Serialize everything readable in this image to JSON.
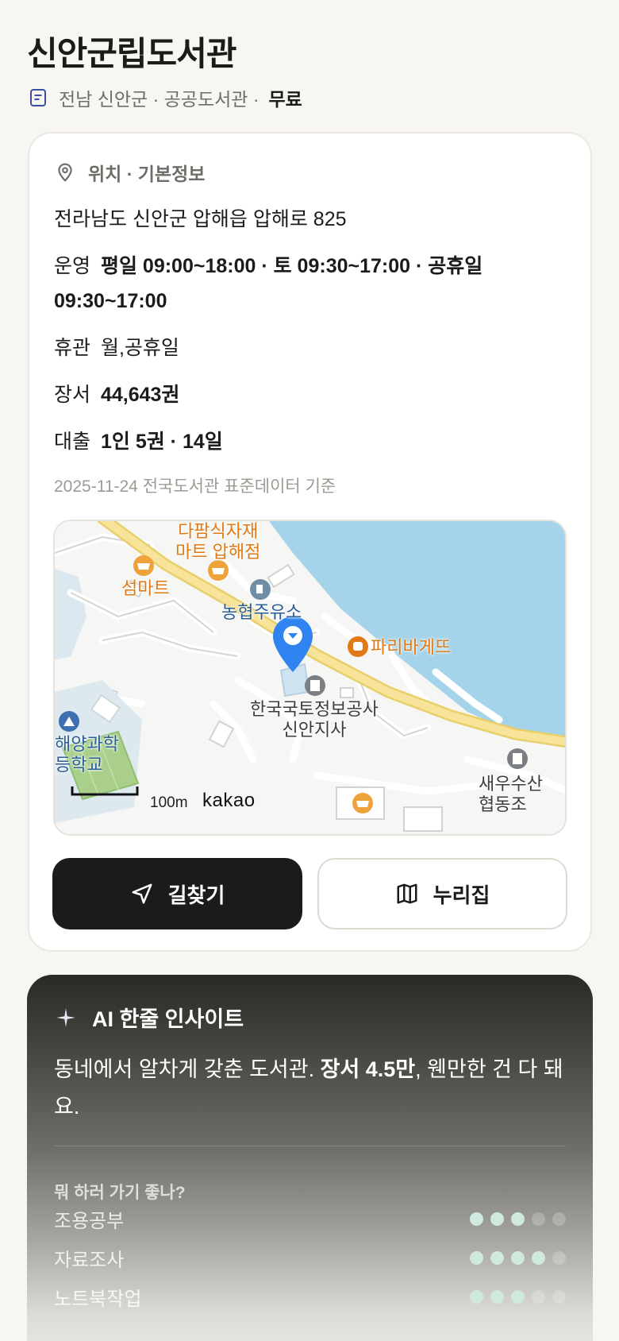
{
  "header": {
    "title": "신안군립도서관",
    "region": "전남 신안군 · 공공도서관 ·",
    "fee": "무료"
  },
  "info": {
    "section_title": "위치 · 기본정보",
    "address": "전라남도 신안군 압해읍 압해로 825",
    "hours_label": "운영",
    "hours_value": "평일 09:00~18:00 · 토 09:30~17:00 · 공휴일 09:30~17:00",
    "closed_label": "휴관",
    "closed_value": "월,공휴일",
    "books_label": "장서",
    "books_value": "44,643권",
    "loan_label": "대출",
    "loan_value": "1인 5권 · 14일",
    "data_stamp": "2025-11-24 전국도서관 표준데이터 기준"
  },
  "map": {
    "labels": {
      "mart1_line1": "다팜식자재",
      "mart1_line2": "마트 압해점",
      "mart2": "섬마트",
      "gas": "농협주유소",
      "bakery": "파리바게뜨",
      "office_line1": "한국국토정보공사",
      "office_line2": "신안지사",
      "school_line1": "해양과학",
      "school_line2": "등학교",
      "coop_line1": "새우수산",
      "coop_line2": "협동조"
    },
    "scale": "100m",
    "attribution": "kakao"
  },
  "actions": {
    "directions": "길찾기",
    "website": "누리집"
  },
  "ai": {
    "title": "AI 한줄 인사이트",
    "text_before": "동네에서 알차게 갖춘 도서관. ",
    "text_bold": "장서 4.5만",
    "text_after": ", 웬만한 건 다 돼요.",
    "question": "뭐 하러 가기 좋나?",
    "ratings": [
      {
        "label": "조용공부",
        "score": 3,
        "max": 5
      },
      {
        "label": "자료조사",
        "score": 4,
        "max": 5
      },
      {
        "label": "노트북작업",
        "score": 3,
        "max": 5
      }
    ]
  },
  "colors": {
    "accent_dark": "#1c1b19",
    "map_water": "#a5d4ea",
    "map_road": "#f2dc84",
    "pin": "#2f84f2",
    "poi_orange": "#e07a17",
    "rating_on": "#cfe9de"
  }
}
